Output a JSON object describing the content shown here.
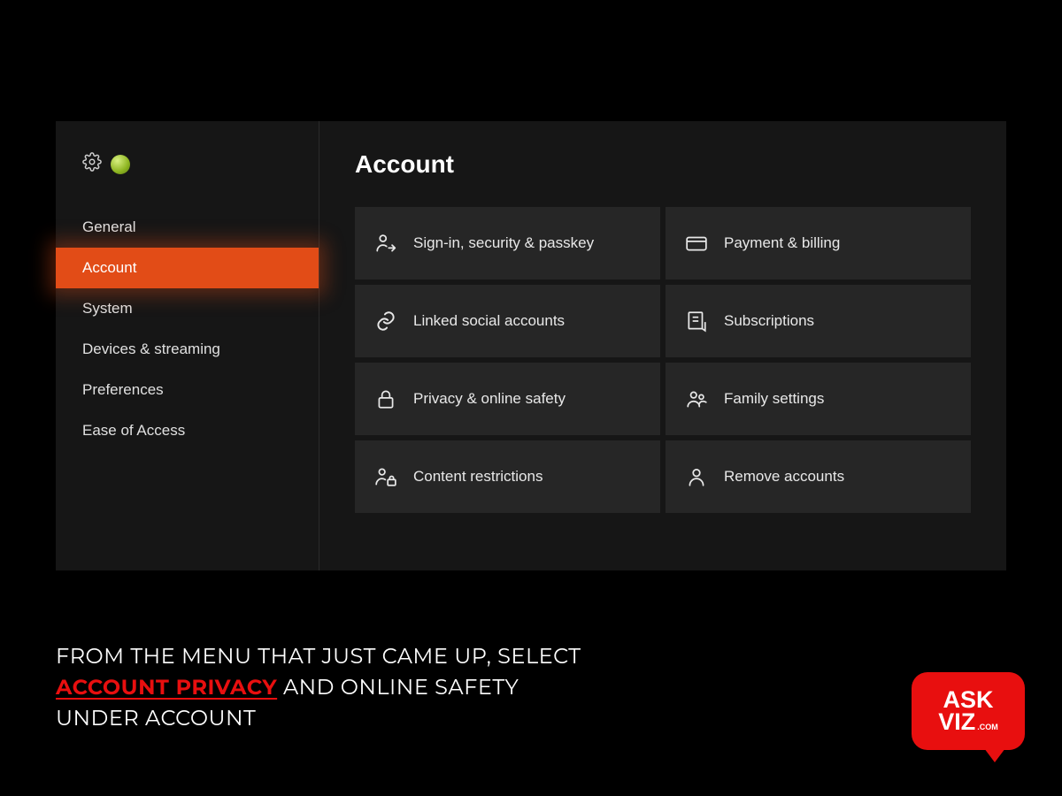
{
  "page_title": "Account",
  "sidebar": {
    "items": [
      {
        "label": "General"
      },
      {
        "label": "Account"
      },
      {
        "label": "System"
      },
      {
        "label": "Devices & streaming"
      },
      {
        "label": "Preferences"
      },
      {
        "label": "Ease of Access"
      }
    ]
  },
  "tiles": [
    {
      "label": "Sign-in, security & passkey"
    },
    {
      "label": "Payment & billing"
    },
    {
      "label": "Linked social accounts"
    },
    {
      "label": "Subscriptions"
    },
    {
      "label": "Privacy & online safety"
    },
    {
      "label": "Family settings"
    },
    {
      "label": "Content restrictions"
    },
    {
      "label": "Remove accounts"
    }
  ],
  "caption": {
    "line1_a": "From the menu that just came up, select",
    "highlight": "Account Privacy",
    "line2_b": " and online safety",
    "line3": "under account"
  },
  "logo": {
    "line1": "ASK",
    "line2": "VIZ",
    "sub": ".COM"
  }
}
